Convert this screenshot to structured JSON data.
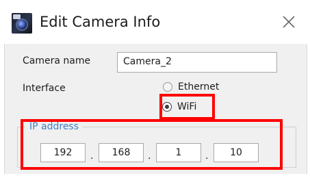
{
  "window": {
    "title": "Edit Camera Info",
    "app_icon": "camera-app-icon",
    "close_icon": "close-icon"
  },
  "form": {
    "camera_name_label": "Camera name",
    "camera_name_value": "Camera_2",
    "interface_label": "Interface",
    "interface_options": [
      {
        "label": "Ethernet",
        "selected": false
      },
      {
        "label": "WiFi",
        "selected": true
      }
    ]
  },
  "ip_group": {
    "legend": "IP address",
    "octets": [
      "192",
      "168",
      "1",
      "10"
    ],
    "separator": "."
  },
  "annotations": {
    "highlight_color": "#ff0000",
    "legend_color": "#3c7fc4"
  }
}
